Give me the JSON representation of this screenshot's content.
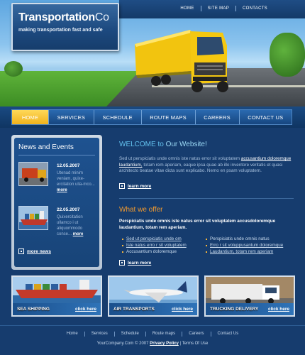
{
  "header": {
    "logo_main": "Transportation",
    "logo_co": "Co",
    "tagline": "making transportation fast and safe",
    "top_nav": [
      "HOME",
      "SITE MAP",
      "CONTACTS"
    ]
  },
  "main_nav": [
    "HOME",
    "SERVICES",
    "SCHEDULE",
    "ROUTE MAPS",
    "CAREERS",
    "CONTACT US"
  ],
  "news": {
    "title": "News and Events",
    "items": [
      {
        "date": "12.05.2007",
        "text": "Utenad minim veniam, quixe-ercitation ulla-mco...",
        "more": "more"
      },
      {
        "date": "22.05.2007",
        "text": "Quixercitation ullamco i ut aliquommodo conse...",
        "more": "more"
      }
    ],
    "more_news": "more news"
  },
  "welcome": {
    "title_a": "WELCOME to",
    "title_b": "Our Website!",
    "text_pre": "Sed ut perspiciatis unde omnis iste natus error sit voluptatem",
    "text_link": "accusantium doloremque laudantium,",
    "text_post": "totam rem aperiam, eaque ipsa quae ab illo inventore veritatis et quasi architecto beatae vitae dicta sunt explicabo. Nemo en psam voluptatem.",
    "learn_more": "learn more"
  },
  "offer": {
    "title": "What we offer",
    "text": "Perspiciatis unde omnis iste natus error sit voluptatem accusdoloremque laudantium, totam rem aperiam.",
    "list_left": [
      "Sed ut perspiciatis unde om",
      "Iste natus erro r sit voluptatem",
      "Accusantium doloremque"
    ],
    "list_right": [
      "Perspiciatis unde omnis natus",
      "Erro r sit voluppusantum doloremque",
      "Laudantium, totam rem aperiam"
    ],
    "learn_more": "learn more"
  },
  "banners": [
    {
      "title": "SEA SHIPPING",
      "click": "click here"
    },
    {
      "title": "AIR TRANSPORTS",
      "click": "click here"
    },
    {
      "title": "TRUCKING DELIVERY",
      "click": "click here"
    }
  ],
  "footer": {
    "nav": [
      "Home",
      "Services",
      "Schedule",
      "Route maps",
      "Careers",
      "Contact Us"
    ],
    "copy_pre": "YourCompany.Com © 2007",
    "privacy": "Privacy Policy",
    "copy_post": "| Terms Of Use"
  }
}
